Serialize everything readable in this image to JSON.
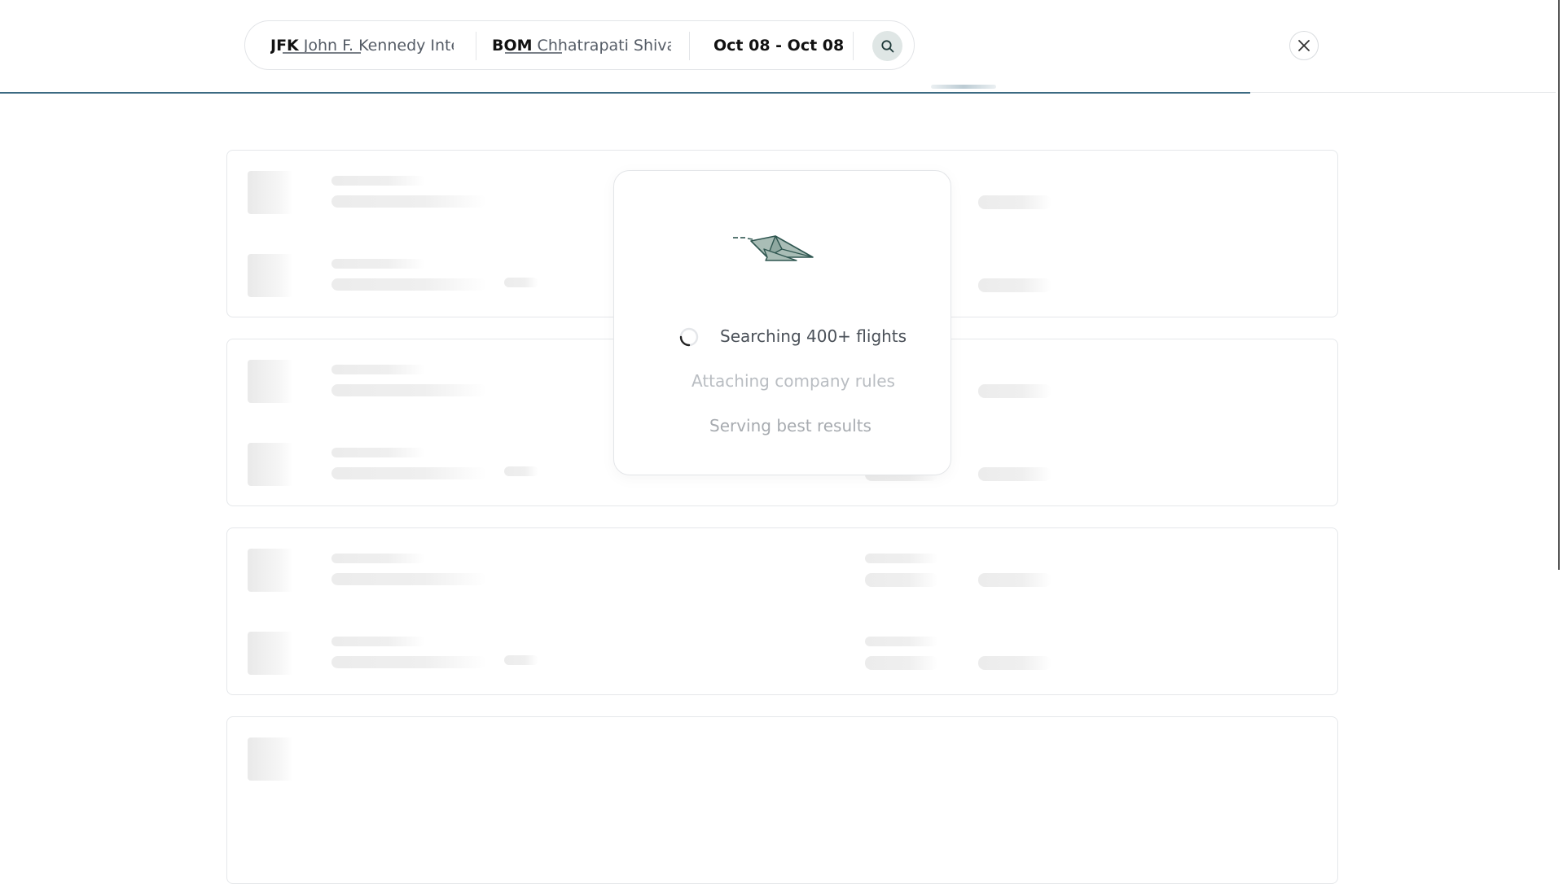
{
  "search": {
    "from_code": "JFK",
    "from_name": "John F. Kennedy Inte",
    "to_code": "BOM",
    "to_name": "Chhatrapati Shivaji",
    "dates": "Oct 08 - Oct 08",
    "search_icon": "search-icon",
    "close_icon": "close-icon"
  },
  "loading": {
    "icon": "paper-plane-icon",
    "steps": [
      {
        "label": "Searching 400+ flights",
        "state": "active"
      },
      {
        "label": "Attaching company rules",
        "state": "pending"
      },
      {
        "label": "Serving best results",
        "state": "pending"
      }
    ]
  },
  "colors": {
    "accent": "#3c6a82",
    "plane_fill": "#a9bdb6",
    "plane_stroke": "#2f5650"
  }
}
